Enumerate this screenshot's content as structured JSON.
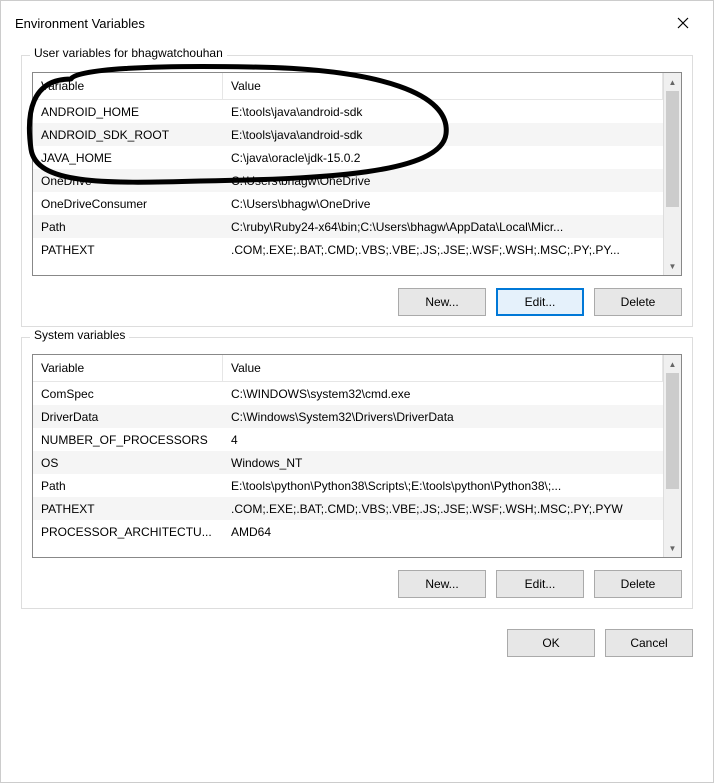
{
  "dialog": {
    "title": "Environment Variables"
  },
  "user_section": {
    "title": "User variables for bhagwatchouhan",
    "columns": {
      "var": "Variable",
      "val": "Value"
    },
    "rows": [
      {
        "var": "ANDROID_HOME",
        "val": "E:\\tools\\java\\android-sdk"
      },
      {
        "var": "ANDROID_SDK_ROOT",
        "val": "E:\\tools\\java\\android-sdk"
      },
      {
        "var": "JAVA_HOME",
        "val": "C:\\java\\oracle\\jdk-15.0.2"
      },
      {
        "var": "OneDrive",
        "val": "C:\\Users\\bhagw\\OneDrive"
      },
      {
        "var": "OneDriveConsumer",
        "val": "C:\\Users\\bhagw\\OneDrive"
      },
      {
        "var": "Path",
        "val": "C:\\ruby\\Ruby24-x64\\bin;C:\\Users\\bhagw\\AppData\\Local\\Micr..."
      },
      {
        "var": "PATHEXT",
        "val": ".COM;.EXE;.BAT;.CMD;.VBS;.VBE;.JS;.JSE;.WSF;.WSH;.MSC;.PY;.PY..."
      }
    ],
    "buttons": {
      "new": "New...",
      "edit": "Edit...",
      "delete": "Delete"
    }
  },
  "system_section": {
    "title": "System variables",
    "columns": {
      "var": "Variable",
      "val": "Value"
    },
    "rows": [
      {
        "var": "ComSpec",
        "val": "C:\\WINDOWS\\system32\\cmd.exe"
      },
      {
        "var": "DriverData",
        "val": "C:\\Windows\\System32\\Drivers\\DriverData"
      },
      {
        "var": "NUMBER_OF_PROCESSORS",
        "val": "4"
      },
      {
        "var": "OS",
        "val": "Windows_NT"
      },
      {
        "var": "Path",
        "val": "E:\\tools\\python\\Python38\\Scripts\\;E:\\tools\\python\\Python38\\;..."
      },
      {
        "var": "PATHEXT",
        "val": ".COM;.EXE;.BAT;.CMD;.VBS;.VBE;.JS;.JSE;.WSF;.WSH;.MSC;.PY;.PYW"
      },
      {
        "var": "PROCESSOR_ARCHITECTU...",
        "val": "AMD64"
      }
    ],
    "buttons": {
      "new": "New...",
      "edit": "Edit...",
      "delete": "Delete"
    }
  },
  "dialog_buttons": {
    "ok": "OK",
    "cancel": "Cancel"
  }
}
